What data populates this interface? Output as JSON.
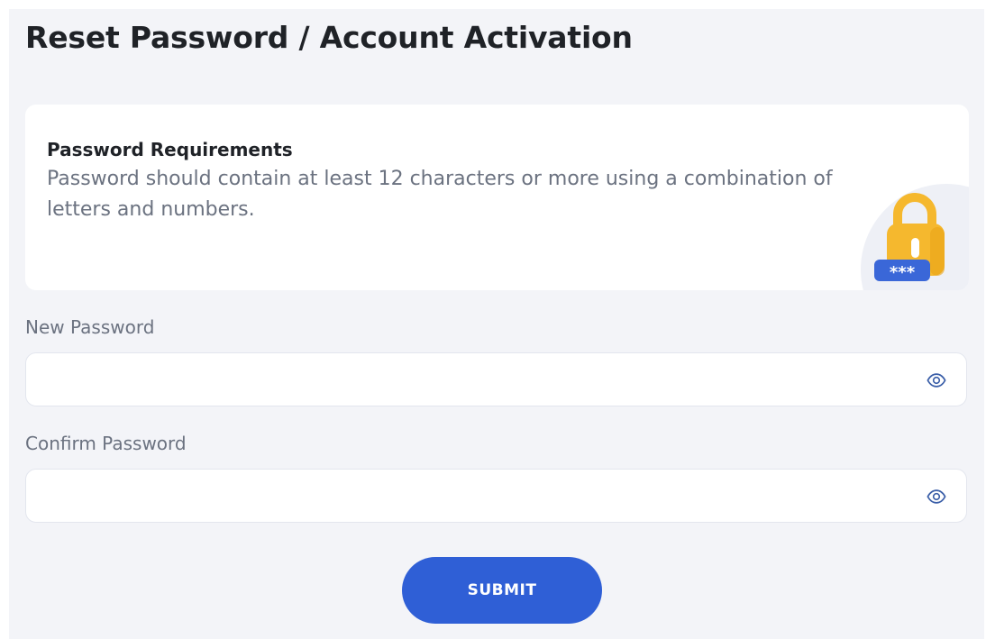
{
  "page": {
    "title": "Reset Password / Account Activation"
  },
  "requirements": {
    "heading": "Password Requirements",
    "text": "Password should contain at least 12 characters or more using a combination of letters and numbers.",
    "illustration_icon": "lock-icon",
    "badge_text": "***"
  },
  "form": {
    "new_password": {
      "label": "New Password",
      "value": "",
      "placeholder": "",
      "toggle_icon": "eye-icon"
    },
    "confirm_password": {
      "label": "Confirm Password",
      "value": "",
      "placeholder": "",
      "toggle_icon": "eye-icon"
    },
    "submit_label": "SUBMIT"
  },
  "colors": {
    "background": "#f3f4f8",
    "card": "#ffffff",
    "accent": "#2f5fd6",
    "lock_body": "#f5b82e",
    "muted_text": "#6b7280"
  }
}
